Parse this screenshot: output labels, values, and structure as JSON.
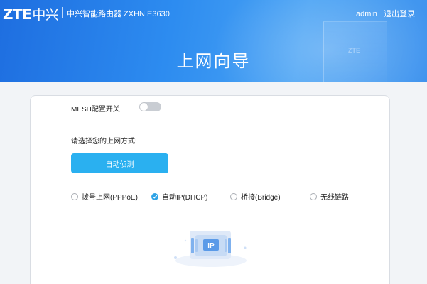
{
  "header": {
    "logo_text": "ZTE",
    "logo_cn": "中兴",
    "product_name": "中兴智能路由器 ZXHN E3630",
    "user": "admin",
    "logout": "退出登录",
    "title": "上网向导",
    "watermark": "ZTE"
  },
  "mesh": {
    "label": "MESH配置开关",
    "enabled": false
  },
  "wizard": {
    "prompt": "请选择您的上网方式:",
    "detect_button": "自动侦测",
    "options": [
      {
        "label": "拨号上网(PPPoE)",
        "checked": false
      },
      {
        "label": "自动IP(DHCP)",
        "checked": true
      },
      {
        "label": "桥接(Bridge)",
        "checked": false
      },
      {
        "label": "无线链路",
        "checked": false
      }
    ],
    "illustration_text": "IP"
  },
  "colors": {
    "banner": "#2d8cf0",
    "accent": "#2ab0f0",
    "radio_checked": "#2ea3e6"
  }
}
